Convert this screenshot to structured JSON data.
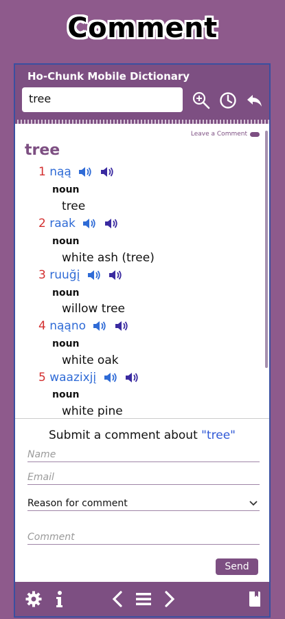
{
  "banner": {
    "title": "Comment"
  },
  "app": {
    "title": "Ho-Chunk Mobile Dictionary"
  },
  "search": {
    "value": "tree"
  },
  "header_icons": [
    "zoom-in-icon",
    "history-icon",
    "back-arrow-icon"
  ],
  "leave_comment": "Leave a Comment",
  "headword": "tree",
  "entries": [
    {
      "num": "1",
      "word": "nąą",
      "pos": "noun",
      "def": "tree"
    },
    {
      "num": "2",
      "word": "raak",
      "pos": "noun",
      "def": "white ash (tree)"
    },
    {
      "num": "3",
      "word": "ruuğį",
      "pos": "noun",
      "def": "willow tree"
    },
    {
      "num": "4",
      "word": "nąąno",
      "pos": "noun",
      "def": "white oak"
    },
    {
      "num": "5",
      "word": "waazixjį",
      "pos": "noun",
      "def": "white pine"
    }
  ],
  "comment": {
    "title_prefix": "Submit a comment about ",
    "term": "\"tree\"",
    "name_placeholder": "Name",
    "email_placeholder": "Email",
    "reason_value": "Reason for comment",
    "comment_placeholder": "Comment",
    "send_label": "Send"
  },
  "footer_icons": [
    "settings-icon",
    "info-icon",
    "prev-icon",
    "menu-icon",
    "next-icon",
    "bookmark-icon"
  ],
  "colors": {
    "accent": "#7d4f82",
    "background": "#8e5a8c",
    "number": "#d32f2f",
    "word": "#2f6bd6"
  }
}
